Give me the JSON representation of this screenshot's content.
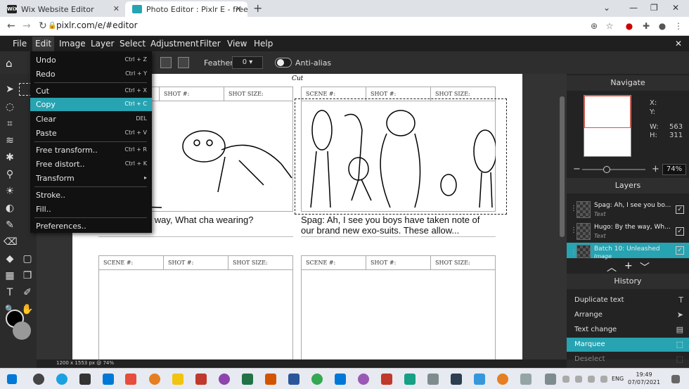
{
  "browser": {
    "tabs": [
      {
        "title": "Wix Website Editor",
        "favicon": "WiX"
      },
      {
        "title": "Photo Editor : Pixlr E - free image",
        "favicon": ""
      }
    ],
    "url": "pixlr.com/e/#editor"
  },
  "menu": [
    "File",
    "Edit",
    "Image",
    "Layer",
    "Select",
    "Adjustment",
    "Filter",
    "View",
    "Help"
  ],
  "toolbar": {
    "feather_label": "Feather:",
    "feather_value": "0",
    "antialias_label": "Anti-alias"
  },
  "edit_menu": [
    {
      "label": "Undo",
      "shortcut": "Ctrl + Z"
    },
    {
      "label": "Redo",
      "shortcut": "Ctrl + Y"
    },
    {
      "label": "Cut",
      "shortcut": "Ctrl + X"
    },
    {
      "label": "Copy",
      "shortcut": "Ctrl + C"
    },
    {
      "label": "Clear",
      "shortcut": "DEL"
    },
    {
      "label": "Paste",
      "shortcut": "Ctrl + V"
    },
    {
      "label": "Free transform..",
      "shortcut": "Ctrl + R"
    },
    {
      "label": "Free distort..",
      "shortcut": "Ctrl + K"
    },
    {
      "label": "Transform",
      "shortcut": "▸"
    },
    {
      "label": "Stroke..",
      "shortcut": ""
    },
    {
      "label": "Fill..",
      "shortcut": ""
    },
    {
      "label": "Preferences..",
      "shortcut": ""
    }
  ],
  "storyboard": {
    "scene_label": "SCENE #:",
    "shot_label": "SHOT #:",
    "shot_size_label": "SHOT SIZE:",
    "cut_label": "Cut",
    "caption_left": "Hugo: By the way, What cha wearing?",
    "caption_right_1": "Spag: Ah, I see you boys have taken note of",
    "caption_right_2": "our brand new exo-suits. These allow..."
  },
  "navigate": {
    "title": "Navigate",
    "x_label": "X:",
    "x_value": "",
    "y_label": "Y:",
    "y_value": "",
    "w_label": "W:",
    "w_value": "563",
    "h_label": "H:",
    "h_value": "311",
    "zoom": "74%"
  },
  "layers": {
    "title": "Layers",
    "items": [
      {
        "name": "Spag: Ah, I see you bo...",
        "type": "Text"
      },
      {
        "name": "Hugo: By the way, Wh...",
        "type": "Text"
      },
      {
        "name": "Batch 10: Unleashed",
        "type": "Image"
      }
    ]
  },
  "history": {
    "title": "History",
    "items": [
      "Duplicate text",
      "Arrange",
      "Text change",
      "Marquee",
      "Deselect"
    ]
  },
  "status": "1200 x 1553 px @ 74%",
  "taskbar": {
    "lang": "ENG",
    "time": "19:49",
    "date": "07/07/2021"
  },
  "colors": {
    "accent": "#27a3b1",
    "menu_bg": "#111111",
    "panel_bg": "#232323"
  }
}
